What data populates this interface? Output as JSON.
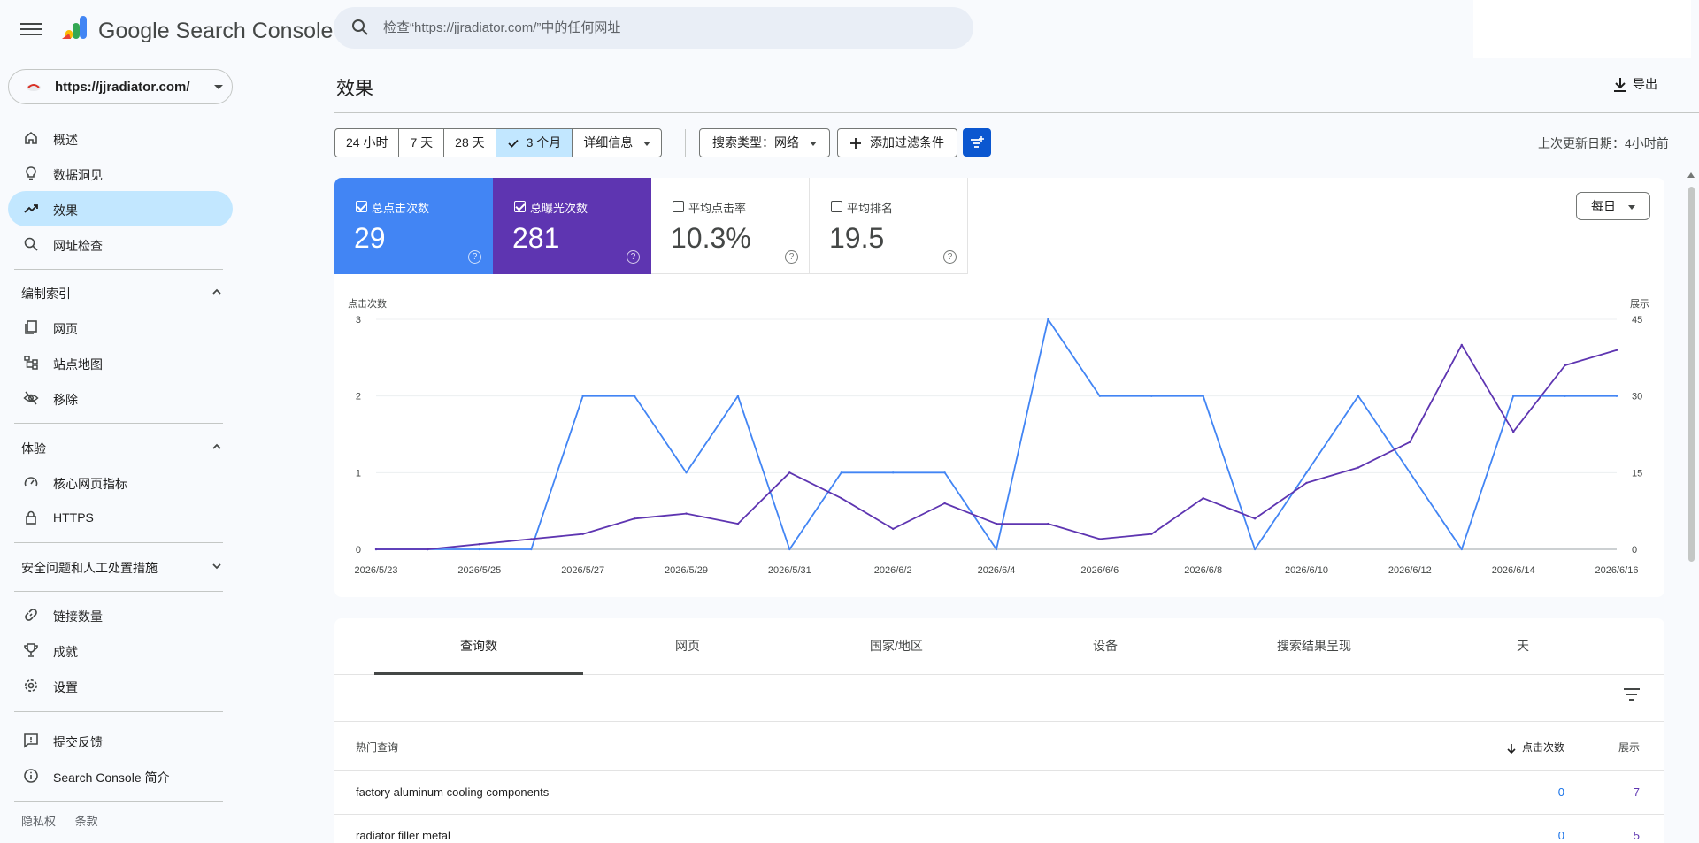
{
  "app": {
    "title": "Google Search Console"
  },
  "search": {
    "placeholder": "检查“https://jjradiator.com/”中的任何网址"
  },
  "property": {
    "label": "https://jjradiator.com/"
  },
  "sidebar": {
    "items": [
      {
        "label": "概述",
        "icon": "home-icon"
      },
      {
        "label": "数据洞见",
        "icon": "lightbulb-icon"
      },
      {
        "label": "效果",
        "icon": "trending-up-icon",
        "active": true
      },
      {
        "label": "网址检查",
        "icon": "search-icon"
      }
    ],
    "index_section": {
      "label": "编制索引",
      "items": [
        {
          "label": "网页",
          "icon": "pages-icon"
        },
        {
          "label": "站点地图",
          "icon": "sitemap-icon"
        },
        {
          "label": "移除",
          "icon": "eye-off-icon"
        }
      ]
    },
    "experience_section": {
      "label": "体验",
      "items": [
        {
          "label": "核心网页指标",
          "icon": "speedometer-icon"
        },
        {
          "label": "HTTPS",
          "icon": "lock-icon"
        }
      ]
    },
    "security_section": {
      "label": "安全问题和人工处置措施"
    },
    "more_items": [
      {
        "label": "链接数量",
        "icon": "link-icon"
      },
      {
        "label": "成就",
        "icon": "trophy-icon"
      },
      {
        "label": "设置",
        "icon": "gear-icon"
      }
    ],
    "bottom_items": [
      {
        "label": "提交反馈",
        "icon": "feedback-icon"
      },
      {
        "label": "Search Console 简介",
        "icon": "info-icon"
      }
    ],
    "footer": {
      "privacy": "隐私权",
      "terms": "条款"
    }
  },
  "header": {
    "title": "效果",
    "export": "导出"
  },
  "filters": {
    "ranges": [
      "24 小时",
      "7 天",
      "28 天",
      "3 个月"
    ],
    "selected_range": "3 个月",
    "details": "详细信息",
    "search_type": "搜索类型：网络",
    "add_filter": "添加过滤条件",
    "last_updated": "上次更新日期：4小时前"
  },
  "metrics": {
    "clicks": {
      "label": "总点击次数",
      "value": "29",
      "checked": true,
      "color": "#4285f4"
    },
    "impressions": {
      "label": "总曝光次数",
      "value": "281",
      "checked": true,
      "color": "#5e35b1"
    },
    "ctr": {
      "label": "平均点击率",
      "value": "10.3%",
      "checked": false
    },
    "position": {
      "label": "平均排名",
      "value": "19.5",
      "checked": false
    },
    "help_glyph": "?"
  },
  "granularity": "每日",
  "chart_data": {
    "type": "line",
    "left_axis_label": "点击次数",
    "right_axis_label": "展示",
    "left_ylim": [
      0,
      3
    ],
    "left_ticks": [
      0,
      1,
      2,
      3
    ],
    "right_ylim": [
      0,
      45
    ],
    "right_ticks": [
      0,
      15,
      30,
      45
    ],
    "x": [
      "2026/5/23",
      "2026/5/24",
      "2026/5/25",
      "2026/5/26",
      "2026/5/27",
      "2026/5/28",
      "2026/5/29",
      "2026/5/30",
      "2026/5/31",
      "2026/6/1",
      "2026/6/2",
      "2026/6/3",
      "2026/6/4",
      "2026/6/5",
      "2026/6/6",
      "2026/6/7",
      "2026/6/8",
      "2026/6/9",
      "2026/6/10",
      "2026/6/11",
      "2026/6/12",
      "2026/6/13",
      "2026/6/14",
      "2026/6/15",
      "2026/6/16"
    ],
    "x_tick_labels": [
      "2026/5/23",
      "2026/5/25",
      "2026/5/27",
      "2026/5/29",
      "2026/5/31",
      "2026/6/2",
      "2026/6/4",
      "2026/6/6",
      "2026/6/8",
      "2026/6/10",
      "2026/6/12",
      "2026/6/14",
      "2026/6/16"
    ],
    "grid": true,
    "series": [
      {
        "name": "总点击次数",
        "axis": "left",
        "color": "#4285f4",
        "values": [
          0,
          0,
          0,
          0,
          2,
          2,
          1,
          2,
          0,
          1,
          1,
          1,
          0,
          3,
          2,
          2,
          2,
          0,
          1,
          2,
          1,
          0,
          2,
          2,
          2
        ]
      },
      {
        "name": "总曝光次数",
        "axis": "right",
        "color": "#5e35b1",
        "values": [
          0,
          0,
          1,
          2,
          3,
          6,
          7,
          5,
          15,
          10,
          4,
          9,
          5,
          5,
          2,
          3,
          10,
          6,
          13,
          16,
          21,
          40,
          23,
          36,
          39
        ]
      }
    ]
  },
  "table": {
    "tabs": [
      "查询数",
      "网页",
      "国家/地区",
      "设备",
      "搜索结果呈现",
      "天"
    ],
    "selected_tab": "查询数",
    "columns": {
      "query": "热门查询",
      "clicks": "点击次数",
      "impressions": "展示"
    },
    "rows": [
      {
        "query": "factory aluminum cooling components",
        "clicks": "0",
        "impressions": "7"
      },
      {
        "query": "radiator filler metal",
        "clicks": "0",
        "impressions": "5"
      }
    ]
  }
}
